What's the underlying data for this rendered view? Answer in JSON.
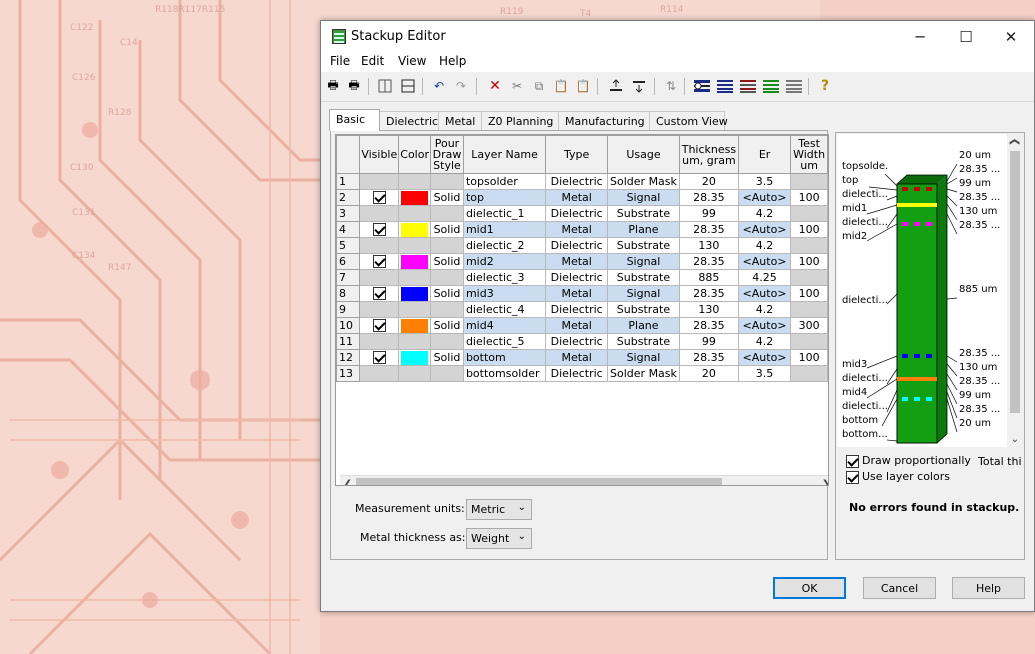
{
  "window": {
    "title": "Stackup Editor"
  },
  "menu": [
    "File",
    "Edit",
    "View",
    "Help"
  ],
  "tabs": [
    "Basic",
    "Dielectric",
    "Metal",
    "Z0 Planning",
    "Manufacturing",
    "Custom View"
  ],
  "table": {
    "headers": [
      "Visible",
      "Color",
      "Pour Draw Style",
      "Layer Name",
      "Type",
      "Usage",
      "Thickness um, gram",
      "Er",
      "Test Width um"
    ],
    "rows": [
      {
        "n": "1",
        "visible": null,
        "color": null,
        "pour": "",
        "name": "topsolder",
        "type": "Dielectric",
        "usage": "Solder Mask",
        "thick": "20",
        "er": "3.5",
        "width": ""
      },
      {
        "n": "2",
        "visible": true,
        "color": "#ff0000",
        "pour": "Solid",
        "name": "top",
        "type": "Metal",
        "usage": "Signal",
        "thick": "28.35",
        "er": "<Auto>",
        "width": "100"
      },
      {
        "n": "3",
        "visible": null,
        "color": null,
        "pour": "",
        "name": "dielectic_1",
        "type": "Dielectric",
        "usage": "Substrate",
        "thick": "99",
        "er": "4.2",
        "width": ""
      },
      {
        "n": "4",
        "visible": true,
        "color": "#ffff00",
        "pour": "Solid",
        "name": "mid1",
        "type": "Metal",
        "usage": "Plane",
        "thick": "28.35",
        "er": "<Auto>",
        "width": "100"
      },
      {
        "n": "5",
        "visible": null,
        "color": null,
        "pour": "",
        "name": "dielectic_2",
        "type": "Dielectric",
        "usage": "Substrate",
        "thick": "130",
        "er": "4.2",
        "width": ""
      },
      {
        "n": "6",
        "visible": true,
        "color": "#ff00ff",
        "pour": "Solid",
        "name": "mid2",
        "type": "Metal",
        "usage": "Signal",
        "thick": "28.35",
        "er": "<Auto>",
        "width": "100"
      },
      {
        "n": "7",
        "visible": null,
        "color": null,
        "pour": "",
        "name": "dielectic_3",
        "type": "Dielectric",
        "usage": "Substrate",
        "thick": "885",
        "er": "4.25",
        "width": ""
      },
      {
        "n": "8",
        "visible": true,
        "color": "#0000ff",
        "pour": "Solid",
        "name": "mid3",
        "type": "Metal",
        "usage": "Signal",
        "thick": "28.35",
        "er": "<Auto>",
        "width": "100"
      },
      {
        "n": "9",
        "visible": null,
        "color": null,
        "pour": "",
        "name": "dielectic_4",
        "type": "Dielectric",
        "usage": "Substrate",
        "thick": "130",
        "er": "4.2",
        "width": ""
      },
      {
        "n": "10",
        "visible": true,
        "color": "#ff8000",
        "pour": "Solid",
        "name": "mid4",
        "type": "Metal",
        "usage": "Plane",
        "thick": "28.35",
        "er": "<Auto>",
        "width": "300"
      },
      {
        "n": "11",
        "visible": null,
        "color": null,
        "pour": "",
        "name": "dielectic_5",
        "type": "Dielectric",
        "usage": "Substrate",
        "thick": "99",
        "er": "4.2",
        "width": ""
      },
      {
        "n": "12",
        "visible": true,
        "color": "#00ffff",
        "pour": "Solid",
        "name": "bottom",
        "type": "Metal",
        "usage": "Signal",
        "thick": "28.35",
        "er": "<Auto>",
        "width": "100"
      },
      {
        "n": "13",
        "visible": null,
        "color": null,
        "pour": "",
        "name": "bottomsolder",
        "type": "Dielectric",
        "usage": "Solder Mask",
        "thick": "20",
        "er": "3.5",
        "width": ""
      }
    ]
  },
  "form": {
    "units_label": "Measurement units:",
    "units_value": "Metric",
    "metal_label": "Metal thickness as:",
    "metal_value": "Weight"
  },
  "stack_view": {
    "labels": [
      "topsolde.",
      "top",
      "dielecti...",
      "mid1",
      "dielecti...",
      "mid2",
      "dielecti...",
      "mid3",
      "dielecti...",
      "mid4",
      "dielecti...",
      "bottom",
      "bottom..."
    ],
    "values": [
      "20 um",
      "28.35 ...",
      "99 um",
      "28.35 ...",
      "130 um",
      "28.35 ...",
      "885 um",
      "28.35 ...",
      "130 um",
      "28.35 ...",
      "99 um",
      "28.35 ...",
      "20 um"
    ],
    "draw_proportionally": "Draw proportionally",
    "total": "Total thi",
    "use_layer_colors": "Use layer colors",
    "status": "No errors found in stackup."
  },
  "buttons": {
    "ok": "OK",
    "cancel": "Cancel",
    "help": "Help"
  }
}
